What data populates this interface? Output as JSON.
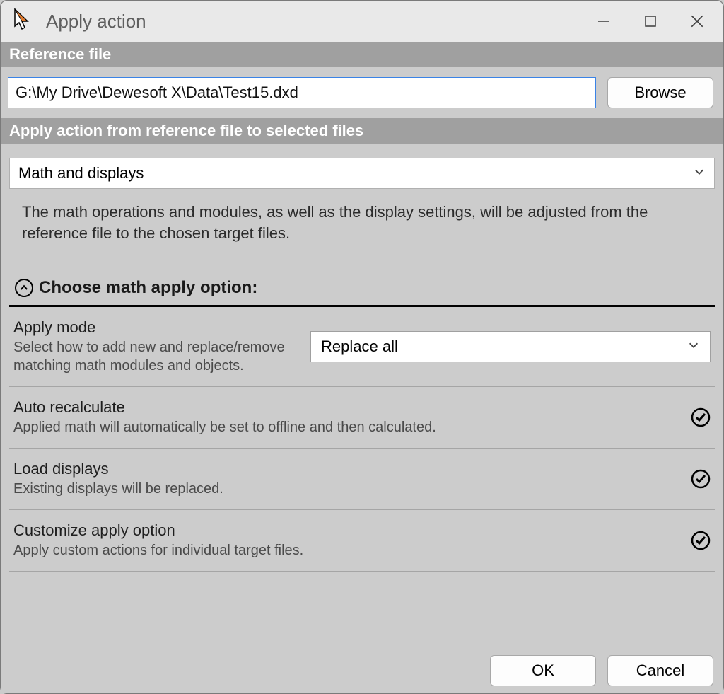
{
  "window": {
    "title": "Apply action"
  },
  "sections": {
    "reference_file": "Reference file",
    "apply_action": "Apply action from reference file to selected files"
  },
  "reference": {
    "path": "G:\\My Drive\\Dewesoft X\\Data\\Test15.dxd",
    "browse": "Browse"
  },
  "action_dropdown": {
    "selected": "Math and displays"
  },
  "action_description": "The math operations and modules, as well as the display settings, will be adjusted from the reference file to the chosen target files.",
  "group": {
    "title": "Choose math apply option:"
  },
  "apply_mode": {
    "title": "Apply mode",
    "sub": "Select how to add new and replace/remove matching math modules and objects.",
    "selected": "Replace all"
  },
  "auto_recalc": {
    "title": "Auto recalculate",
    "sub": "Applied math will automatically be set to offline and then calculated.",
    "checked": true
  },
  "load_displays": {
    "title": "Load displays",
    "sub": "Existing displays will be replaced.",
    "checked": true
  },
  "customize": {
    "title": "Customize apply option",
    "sub": "Apply custom actions for individual target files.",
    "checked": true
  },
  "buttons": {
    "ok": "OK",
    "cancel": "Cancel"
  }
}
